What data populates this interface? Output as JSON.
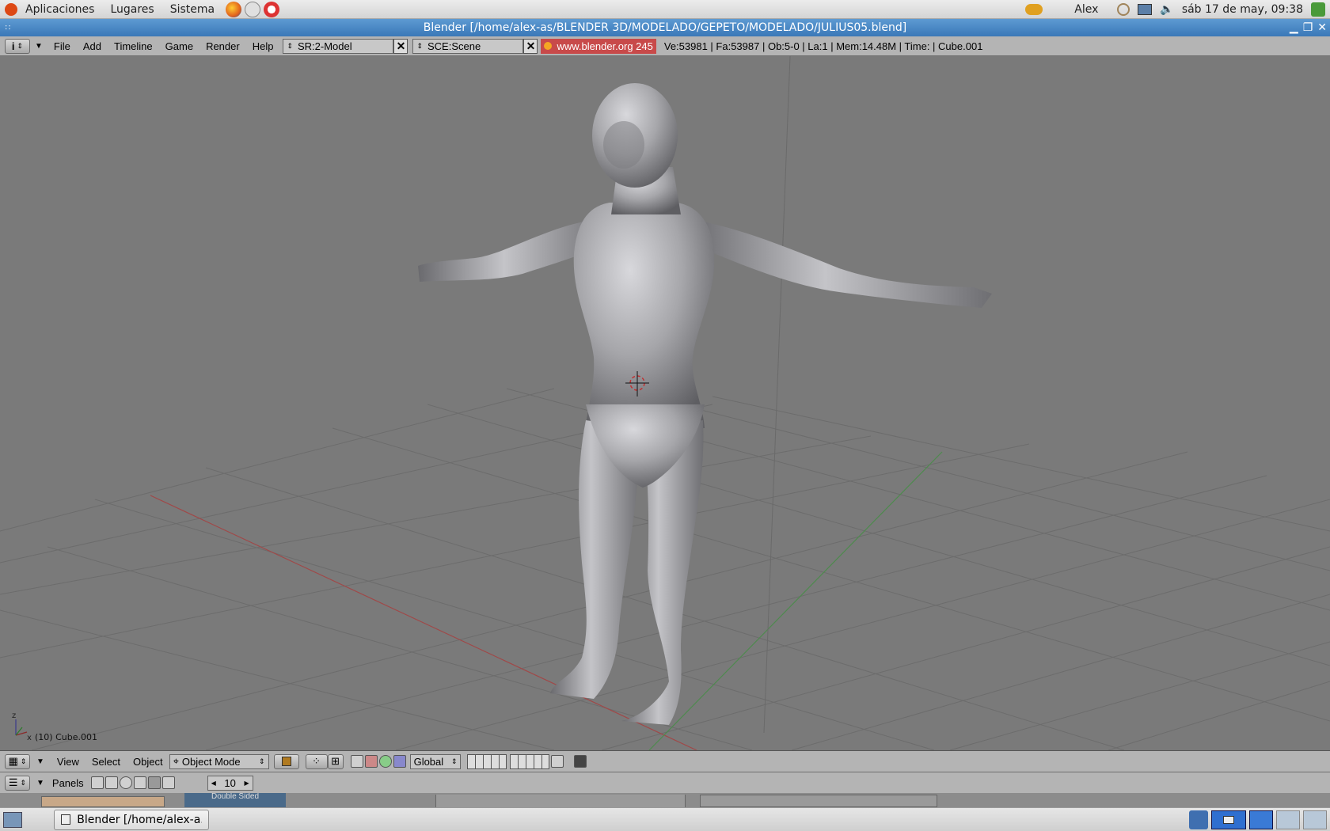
{
  "top_panel": {
    "menus": [
      "Aplicaciones",
      "Lugares",
      "Sistema"
    ],
    "user": "Alex",
    "clock": "sáb 17 de may, 09:38"
  },
  "window": {
    "title": "Blender [/home/alex-as/BLENDER 3D/MODELADO/GEPETO/MODELADO/JULIUS05.blend]"
  },
  "blender_header": {
    "menus": [
      "File",
      "Add",
      "Timeline",
      "Game",
      "Render",
      "Help"
    ],
    "screen": "SR:2-Model",
    "scene": "SCE:Scene",
    "url": "www.blender.org 245",
    "stats": "Ve:53981 | Fa:53987 | Ob:5-0 | La:1  | Mem:14.48M  | Time: | Cube.001"
  },
  "viewport": {
    "object_label": "(10) Cube.001",
    "axis_z": "z",
    "axis_x": "x"
  },
  "view3d_header": {
    "menus": [
      "View",
      "Select",
      "Object"
    ],
    "mode": "Object Mode",
    "orientation": "Global"
  },
  "buttons_header": {
    "panels_label": "Panels",
    "frame": "10",
    "tab_label": "Double Sided"
  },
  "taskbar": {
    "task": "Blender [/home/alex-a..."
  }
}
